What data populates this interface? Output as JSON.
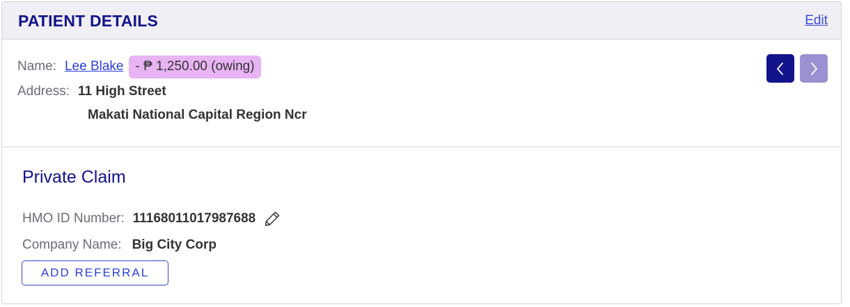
{
  "header": {
    "title": "PATIENT DETAILS",
    "edit_label": "Edit"
  },
  "patient": {
    "name_label": "Name:",
    "name": "Lee Blake ",
    "balance_badge": "- ₱ 1,250.00 (owing)",
    "address_label": "Address:",
    "address_line1": "11 High Street",
    "address_line2": "Makati National Capital Region Ncr",
    "prev_icon": "chevron-left-icon",
    "next_icon": "chevron-right-icon"
  },
  "claim": {
    "title": "Private Claim",
    "hmo_label": "HMO ID Number:",
    "hmo_value": "11168011017987688",
    "company_label": "Company Name:",
    "company_value": "Big City Corp",
    "add_referral_label": "ADD REFERRAL",
    "edit_icon": "pencil-icon"
  },
  "colors": {
    "accent": "#12128a",
    "link": "#2b3fd6",
    "badge": "#e8b4f4",
    "header_bg": "#f0eff5"
  }
}
